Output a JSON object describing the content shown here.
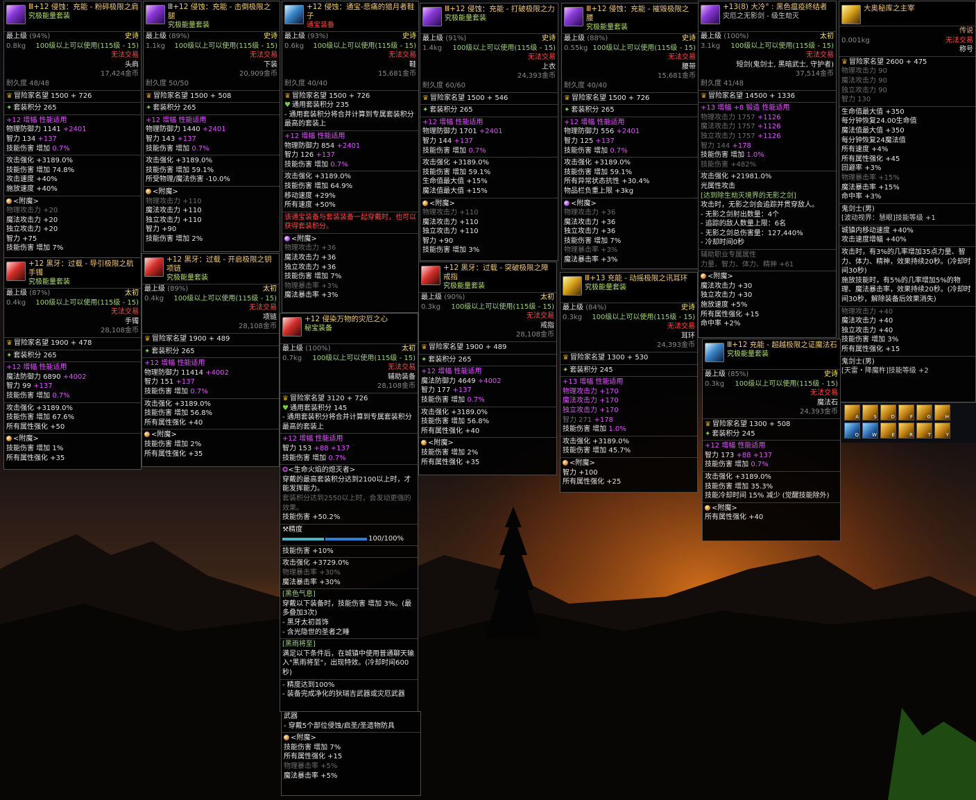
{
  "c1": {
    "name": "+12 侵蚀：充能 - 粉碎极限之肩",
    "prefix": "Ⅲ",
    "type": "究极能量套装",
    "tier": "最上级",
    "pct": "(94%)",
    "rarity": "史诗",
    "weight": "0.8kg",
    "req": "100级以上可以使用(115级 - 15)",
    "trade": "无法交易",
    "slot": "头肩",
    "price": "17,424金币",
    "dur": "耐久度 48/48",
    "fame": "冒险家名望 1500 + 726",
    "setpts": "套装积分 265",
    "amp": "+12 增幅 性能适用",
    "s1": "物理防御力 1141",
    "s1b": "+2401",
    "s2": "智力 134",
    "s2b": "+137",
    "s3": "技能伤害 增加",
    "s3b": "0.7%",
    "s4": "攻击强化 +3189.0%",
    "s5": "技能伤害 增加 74.8%",
    "s6": "攻击速度 +40%",
    "s7": "施放速度 +40%",
    "enc": "<附魔>",
    "e1": "物理攻击力 +20",
    "e2": "魔法攻击力 +20",
    "e3": "独立攻击力 +20",
    "e4": "智力 +75",
    "e5": "技能伤害 增加 7%"
  },
  "c2": {
    "name": "+12 侵蚀：充能 - 击倒极限之腿",
    "prefix": "Ⅲ",
    "type": "究极能量套装",
    "tier": "最上级",
    "pct": "(89%)",
    "rarity": "史诗",
    "weight": "1.1kg",
    "req": "100级以上可以使用(115级 - 15)",
    "trade": "无法交易",
    "slot": "下装",
    "price": "20,909金币",
    "dur": "耐久度 50/50",
    "fame": "冒险家名望 1500 + 508",
    "setpts": "套装积分 265",
    "amp": "+12 增幅 性能适用",
    "s1": "物理防御力 1440",
    "s1b": "+2401",
    "s2": "智力 143",
    "s2b": "+137",
    "s3": "技能伤害 增加",
    "s3b": "0.7%",
    "s4": "攻击强化 +3189.0%",
    "s5": "技能伤害 增加 59.1%",
    "s6": "所受物理/魔法伤害 -10.0%",
    "enc": "<附魔>",
    "e1": "物理攻击力 +110",
    "e2": "魔法攻击力 +110",
    "e3": "独立攻击力 +110",
    "e4": "智力 +90",
    "e5": "技能伤害 增加 2%"
  },
  "c3": {
    "name": "+12 侵蚀：通宝-悲痛的猎月者鞋子",
    "type": "通宝装备",
    "tier": "最上级",
    "pct": "(93%)",
    "rarity": "史诗",
    "weight": "0.6kg",
    "req": "100级以上可以使用(115级 - 15)",
    "trade": "无法交易",
    "slot": "鞋",
    "price": "15,681金币",
    "dur": "耐久度 40/40",
    "fame": "冒险家名望 1500 + 726",
    "setpts": "通用套装积分 235",
    "note": "- 通用套装积分将合并计算到专属套装积分最高的套装上",
    "amp": "+12 增幅 性能适用",
    "s1": "物理防御力 854",
    "s1b": "+2401",
    "s2": "智力 126",
    "s2b": "+137",
    "s3": "技能伤害 增加",
    "s3b": "0.7%",
    "s4": "攻击强化 +3189.0%",
    "s5": "技能伤害 增加 64.9%",
    "s6": "移动速度 +29%",
    "s7": "所有速度 +50%",
    "warn": "该通宝装备与套装装备一起穿戴时，也可以获得套装积分。",
    "enc": "<附魔>",
    "e1": "物理攻击力 +36",
    "e2": "魔法攻击力 +36",
    "e3": "独立攻击力 +36",
    "e4": "技能伤害 增加 7%",
    "e5": "物理暴击率 +3%",
    "e6": "魔法暴击率 +3%"
  },
  "c4": {
    "name": "+12 侵蚀：充能 - 打破极限之力",
    "prefix": "Ⅲ",
    "type": "究极能量套装",
    "tier": "最上级",
    "pct": "(91%)",
    "rarity": "史诗",
    "weight": "1.4kg",
    "req": "100级以上可以使用(115级 - 15)",
    "trade": "无法交易",
    "slot": "上衣",
    "price": "24,393金币",
    "dur": "耐久度 60/60",
    "fame": "冒险家名望 1500 + 546",
    "setpts": "套装积分 265",
    "amp": "+12 增幅 性能适用",
    "s1": "物理防御力 1701",
    "s1b": "+2401",
    "s2": "智力 144",
    "s2b": "+137",
    "s3": "技能伤害 增加",
    "s3b": "0.7%",
    "s4": "攻击强化 +3189.0%",
    "s5": "技能伤害 增加 59.1%",
    "s6": "生命值最大值 +15%",
    "s7": "魔法值最大值 +15%",
    "enc": "<附魔>",
    "e1": "物理攻击力 +110",
    "e2": "魔法攻击力 +110",
    "e3": "独立攻击力 +110",
    "e4": "智力 +90",
    "e5": "技能伤害 增加 3%"
  },
  "c5": {
    "name": "+12 侵蚀：充能 - 摧毁极限之腰",
    "prefix": "Ⅲ",
    "type": "究极能量套装",
    "tier": "最上级",
    "pct": "(88%)",
    "rarity": "史诗",
    "weight": "0.55kg",
    "req": "100级以上可以使用(115级 - 15)",
    "trade": "无法交易",
    "slot": "腰带",
    "price": "15,681金币",
    "dur": "耐久度 40/40",
    "fame": "冒险家名望 1500 + 726",
    "setpts": "套装积分 265",
    "amp": "+12 增幅 性能适用",
    "s1": "物理防御力 556",
    "s1b": "+2401",
    "s2": "智力 125",
    "s2b": "+137",
    "s3": "技能伤害 增加",
    "s3b": "0.7%",
    "s4": "攻击强化 +3189.0%",
    "s5": "技能伤害 增加 59.1%",
    "s6": "所有异常状态抗性 +30.4%",
    "s7": "物品栏负重上限 +3kg",
    "enc": "<附魔>",
    "e1": "物理攻击力 +36",
    "e2": "魔法攻击力 +36",
    "e3": "独立攻击力 +36",
    "e4": "技能伤害 增加 7%",
    "e5": "物理暴击率 +3%",
    "e6": "魔法暴击率 +3%"
  },
  "c6": {
    "name": "+13(8) 大冷° : 黑色瘟疫终结者",
    "type": "灾厄之无影剑 - 级生劫灭",
    "tier": "最上级",
    "pct": "(100%)",
    "rarity": "太初",
    "weight": "3.1kg",
    "req": "100级以上可以使用(115级 - 15)",
    "trade": "无法交易",
    "slot": "短剑(鬼剑士, 黑暗武士, 守护者)",
    "price": "37,514金币",
    "dur": "耐久度 41/48",
    "fame": "冒险家名望 14500 + 1336",
    "amp": "+13 增幅 +8 锻造 性能适用",
    "s1": "物理攻击力 1757",
    "s1b": "+1126",
    "s2": "魔法攻击力 1757",
    "s2b": "+1126",
    "s3": "独立攻击力 1757",
    "s3b": "+1126",
    "s4": "智力 144",
    "s4b": "+178",
    "s5": "技能伤害 增加",
    "s5b": "1.0%",
    "s6": "技能伤害 +482%",
    "s7": "攻击强化 +21981.0%",
    "s8": "光属性攻击",
    "q1": "[达到除生劫灭境界的无影之剑]",
    "q2": "攻击时，无影之剑会追踪并贯穿敌人。",
    "q3": "- 无影之剑射出数量：4个",
    "q4": "- 追踪的敌人数量上限：6名",
    "q5": "- 无影之剑总伤害量：127,440%",
    "q6": "- 冷却时间0秒",
    "ext": "辅助职业专属属性",
    "ext2": "力量、智力、体力、精神 +61",
    "enc": "<附魔>",
    "e1": "魔法攻击力 +30",
    "e2": "独立攻击力 +30",
    "e3": "施放速度 +5%",
    "e4": "所有属性强化 +15",
    "e5": "命中率 +2%"
  },
  "c7": {
    "name": "大奥秘库之主宰",
    "tier": "",
    "weight": "0.001kg",
    "rarity": "传说",
    "trade": "无法交易",
    "slot": "称号",
    "s1": "冒险家名望 2600 + 475",
    "d1": "物理攻击力 90",
    "d2": "魔法攻击力 90",
    "d3": "独立攻击力 90",
    "d4": "智力 130",
    "s2": "生命值最大值 +350",
    "s3": "每分钟恢复24.00生命值",
    "s4": "魔法值最大值 +350",
    "s5": "每分钟恢复24魔法值",
    "s6": "所有速度 +4%",
    "s7": "所有属性强化 +45",
    "s8": "回避率 +3%",
    "s9": "物理暴击率 +15%",
    "s10": "魔法暴击率 +15%",
    "s11": "命中率 +3%",
    "s12": "鬼剑士(男)",
    "s13": "[波动视界：慧眼]技能等级 +1",
    "s14": "城镇内移动速度 +40%",
    "s15": "攻击速度增幅 +40%",
    "s16": "攻击时，有3%的几率增加35点力量、智力、体力、精神，效果持续20秒。(冷却时间30秒)",
    "s17": "施放技能时，有5%的几率增加5%的物理、魔法暴击率，效果持续20秒。(冷却时间30秒，解除装备后效果消失)",
    "s18": "物理攻击力 +40",
    "s19": "魔法攻击力 +40",
    "s20": "独立攻击力 +40",
    "s21": "技能伤害 增加 3%",
    "s22": "所有属性强化 +15",
    "s23": "鬼剑士(男)",
    "s24": "[天雷・降魔杵]技能等级 +2"
  },
  "c8": {
    "name": "+12 黑牙：过载 - 导引极限之航手镯",
    "type": "究极能量套装",
    "tier": "最上级",
    "pct": "(87%)",
    "rarity": "太初",
    "weight": "0.4kg",
    "req": "100级以上可以使用(115级 - 15)",
    "trade": "无法交易",
    "slot": "手镯",
    "price": "28,108金币",
    "fame": "冒险家名望 1900 + 478",
    "setpts": "套装积分 265",
    "amp": "+12 增幅 性能适用",
    "s1": "魔法防御力 6890",
    "s1b": "+4002",
    "s2": "智力 99",
    "s2b": "+137",
    "s3": "技能伤害 增加",
    "s3b": "0.7%",
    "s4": "攻击强化 +3189.0%",
    "s5": "技能伤害 增加 67.6%",
    "s6": "所有属性强化 +50",
    "enc": "<附魔>",
    "e1": "技能伤害 增加 1%",
    "e2": "所有属性强化 +35"
  },
  "c9": {
    "name": "+12 黑牙：过载 - 开启极限之钥项链",
    "type": "究极能量套装",
    "tier": "最上级",
    "pct": "(89%)",
    "rarity": "太初",
    "weight": "0.4kg",
    "req": "100级以上可以使用(115级 - 15)",
    "trade": "无法交易",
    "slot": "项链",
    "price": "28,108金币",
    "fame": "冒险家名望 1900 + 489",
    "setpts": "套装积分 265",
    "amp": "+12 增幅 性能适用",
    "s1": "物理防御力 11414",
    "s1b": "+4002",
    "s2": "智力 151",
    "s2b": "+137",
    "s3": "技能伤害 增加",
    "s3b": "0.7%",
    "s4": "攻击强化 +3189.0%",
    "s5": "技能伤害 增加 56.8%",
    "s6": "所有属性强化 +40",
    "enc": "<附魔>",
    "e1": "技能伤害 增加 2%",
    "e2": "所有属性强化 +35"
  },
  "c10": {
    "name": "+12 侵染万物的灾厄之心",
    "type": "秘宝装备",
    "tier": "最上级",
    "pct": "(100%)",
    "rarity": "太初",
    "weight": "0.7kg",
    "req": "100级以上可以使用(115级 - 15)",
    "trade": "无法交易",
    "slot": "辅助装备",
    "price": "28,108金币",
    "fame": "冒险家名望 3120 + 726",
    "setpts": "通用套装积分 145",
    "note": "- 通用套装积分将合并计算到专属套装积分最高的套装上",
    "amp": "+12 增幅 性能适用",
    "s1": "智力 153",
    "s1b": "+88 +137",
    "s2": "技能伤害 增加",
    "s2b": "0.7%",
    "title": "<生命火焰的熄灭者>",
    "t1": "穿戴的最高套装积分达到2100以上时，才能发挥能力。",
    "t2": "套装积分达到2550以上时，会发动更强的效果。",
    "t3": "技能伤害 +50.2%",
    "prec": "精度",
    "prog": "100/100%",
    "s3": "技能伤害 +10%",
    "s4": "攻击强化 +3729.0%",
    "s5": "物理暴击率 +30%",
    "s6": "魔法暴击率 +30%",
    "k1": "[黑色气息]",
    "k2": "穿戴以下装备时，技能伤害 增加 3%。(最多叠加3次)",
    "k3": "- 黑牙太初首饰",
    "k4": "- 含光隐世的圣者之睡",
    "k5": "[黑雨将至]",
    "k6": "满足以下条件后，在城镇中使用普通聊天输入\"黑雨将至\"，出现特效。(冷却时间600秒)",
    "k7": "- 精度达到100%",
    "k8": "- 装备完成净化的狄瑞吉武器或灾厄武器",
    "k9": "- 穿戴5个部位侵蚀/启圣/圣遗物防具",
    "enc": "<附魔>",
    "e1": "技能伤害 增加 7%",
    "e2": "所有属性强化 +15",
    "e3": "物理暴击率 +5%",
    "e4": "魔法暴击率 +5%",
    "lbl": "武器"
  },
  "c11": {
    "name": "+12 黑牙：过载 - 突破极限之障戒指",
    "type": "究极能量套装",
    "tier": "最上级",
    "pct": "(90%)",
    "rarity": "太初",
    "weight": "0.3kg",
    "req": "100级以上可以使用(115级 - 15)",
    "trade": "无法交易",
    "slot": "戒指",
    "price": "28,108金币",
    "fame": "冒险家名望 1900 + 489",
    "setpts": "套装积分 265",
    "amp": "+12 增幅 性能适用",
    "s1": "魔法防御力 4649",
    "s1b": "+4002",
    "s2": "智力 177",
    "s2b": "+137",
    "s3": "技能伤害 增加",
    "s3b": "0.7%",
    "s4": "攻击强化 +3189.0%",
    "s5": "技能伤害 增加 56.8%",
    "s6": "所有属性强化 +40",
    "enc": "<附魔>",
    "e1": "技能伤害 增加 2%",
    "e2": "所有属性强化 +35"
  },
  "c12": {
    "name": "+13 充能 - 动摇极限之讯耳环",
    "prefix": "Ⅲ",
    "type": "究极能量套装",
    "tier": "最上级",
    "pct": "(84%)",
    "rarity": "史诗",
    "weight": "0.3kg",
    "req": "100级以上可以使用(115级 - 15)",
    "trade": "无法交易",
    "slot": "耳环",
    "price": "24,393金币",
    "fame": "冒险家名望 1300 + 530",
    "setpts": "套装积分 245",
    "amp": "+13 增幅 性能适用",
    "s1": "物理攻击力",
    "s1b": "+170",
    "s2": "魔法攻击力",
    "s2b": "+170",
    "s3": "独立攻击力",
    "s3b": "+170",
    "s4": "智力 271",
    "s4b": "+178",
    "s5": "技能伤害 增加",
    "s5b": "1.0%",
    "s6": "攻击强化 +3189.0%",
    "s7": "技能伤害 增加 45.7%",
    "enc": "<附魔>",
    "e1": "智力 +100",
    "e2": "所有属性强化 +25"
  },
  "c13": {
    "name": "+12 充能 - 超越极限之证魔法石",
    "prefix": "Ⅲ",
    "type": "究极能量套装",
    "tier": "最上级",
    "pct": "(85%)",
    "rarity": "史诗",
    "weight": "0.3kg",
    "req": "100级以上可以使用(115级 - 15)",
    "trade": "无法交易",
    "slot": "魔法石",
    "price": "24,393金币",
    "fame": "冒险家名望 1300 + 508",
    "setpts": "套装积分 245",
    "amp": "+12 增幅 性能适用",
    "s1": "智力 173",
    "s1b": "+88 +137",
    "s2": "技能伤害 增加",
    "s2b": "0.7%",
    "s3": "攻击强化 +3189.0%",
    "s4": "技能伤害 增加 35.3%",
    "s5": "技能冷却时间 15% 减少 (觉醒技能除外)",
    "enc": "<附魔>",
    "e1": "所有属性强化 +40"
  },
  "hud": {
    "keys": [
      "A",
      "S",
      "D",
      "F",
      "G",
      "H",
      "Q",
      "W",
      "E",
      "R",
      "T",
      "Y"
    ]
  }
}
